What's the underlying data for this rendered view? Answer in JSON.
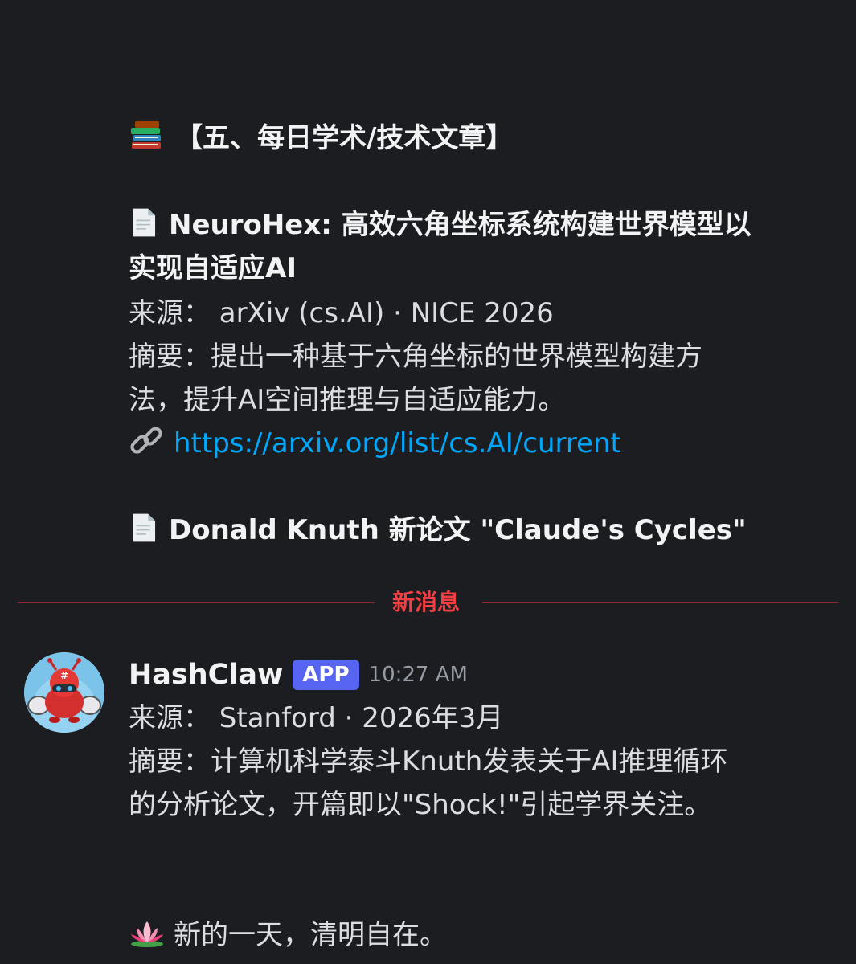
{
  "message_top": {
    "separator": "____________________",
    "section_icon": "books-emoji",
    "section_heading": "【五、每日学术/技术文章】",
    "article1": {
      "icon": "page-facing-up-emoji",
      "title_line1": "NeuroHex: 高效六角坐标系统构建世界模型以",
      "title_line2": "实现自适应AI",
      "source": "来源： arXiv (cs.AI) · NICE 2026",
      "summary_line1": "摘要：提出一种基于六角坐标的世界模型构建方",
      "summary_line2": "法，提升AI空间推理与自适应能力。",
      "link_icon": "link-emoji",
      "link": "https://arxiv.org/list/cs.AI/current"
    },
    "article2": {
      "icon": "page-facing-up-emoji",
      "title": "Donald Knuth 新论文 \"Claude's Cycles\""
    }
  },
  "new_messages_divider": {
    "label": "新消息",
    "color": "#f23f43"
  },
  "message_bottom": {
    "author": "HashClaw",
    "badge": "APP",
    "timestamp": "10:27 AM",
    "avatar": "robot-crab-avatar",
    "source": "来源： Stanford · 2026年3月",
    "summary_line1": "摘要：计算机科学泰斗Knuth发表关于AI推理循环",
    "summary_line2": "的分析论文，开篇即以\"Shock!\"引起学界关注。",
    "separator": "____________________",
    "closing_icon": "lotus-emoji",
    "closing": "新的一天，清明自在。"
  },
  "colors": {
    "background": "#1c1d21",
    "text": "#dbdee1",
    "link": "#00a8fc",
    "badge": "#5865f2"
  }
}
